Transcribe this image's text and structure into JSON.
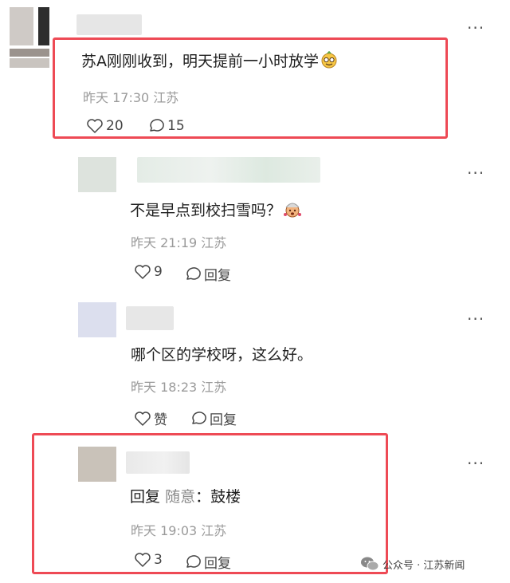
{
  "comments": [
    {
      "text": "苏A刚刚收到，明天提前一小时放学",
      "emoji": "nerd-face-emoji",
      "time": "昨天 17:30",
      "location": "江苏",
      "likes": "20",
      "replies": "15"
    },
    {
      "text": "不是早点到校扫雪吗？",
      "emoji": "exploding-head-emoji",
      "time": "昨天 21:19",
      "location": "江苏",
      "likes": "9",
      "reply_label": "回复"
    },
    {
      "text": "哪个区的学校呀，这么好。",
      "time": "昨天 18:23",
      "location": "江苏",
      "like_label": "赞",
      "reply_label": "回复"
    },
    {
      "reply_prefix": "回复",
      "reply_to": "随意",
      "text": "：鼓楼",
      "time": "昨天 19:03",
      "location": "江苏",
      "likes": "3",
      "reply_label": "回复"
    }
  ],
  "more_label": "···",
  "watermark": "公众号 · 江苏新闻",
  "colors": {
    "highlight": "#ee4a55",
    "meta_text": "#9a9a9a"
  }
}
